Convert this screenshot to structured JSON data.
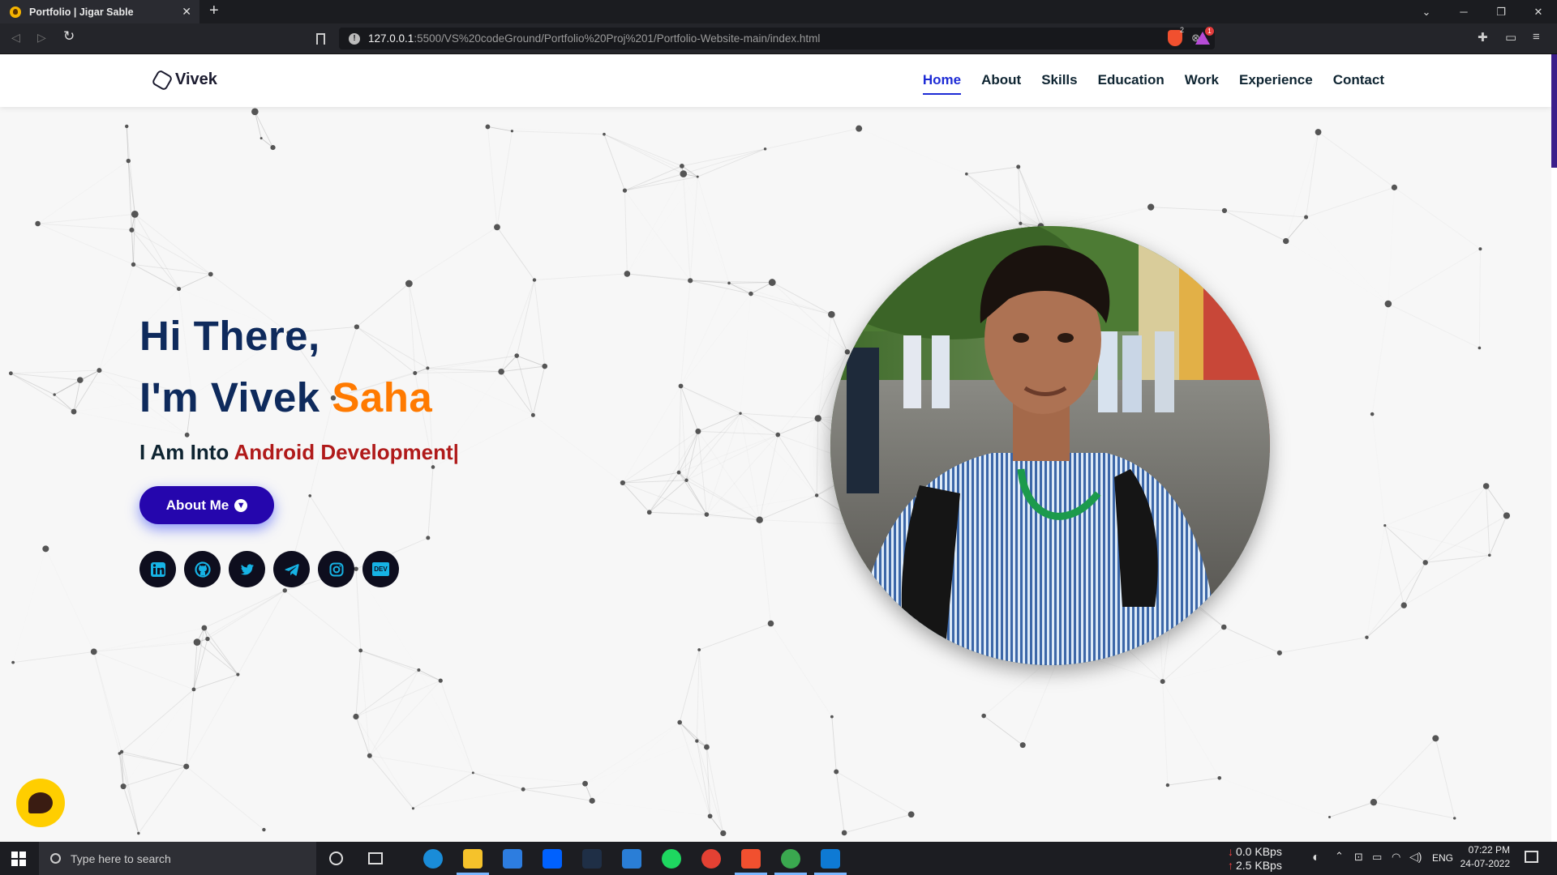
{
  "browser": {
    "tab_title": "Portfolio | Jigar Sable",
    "tab_close": "✕",
    "new_tab": "+",
    "url_host": "127.0.0.1",
    "url_path": ":5500/VS%20codeGround/Portfolio%20Proj%201/Portfolio-Website-main/index.html",
    "brave_badge": "2",
    "alert_badge": "1"
  },
  "site": {
    "logo": "Vivek",
    "nav": [
      "Home",
      "About",
      "Skills",
      "Education",
      "Work",
      "Experience",
      "Contact"
    ],
    "active_nav": "Home",
    "greeting": "Hi There,",
    "name_prefix": "I'm Vivek ",
    "name_accent": "Saha",
    "intro_prefix": "I Am Into ",
    "intro_typed": "Android Development|",
    "about_button": "About Me",
    "social_icons": [
      "linkedin-icon",
      "github-icon",
      "twitter-icon",
      "telegram-icon",
      "instagram-icon",
      "dev-icon"
    ],
    "dev_label": "DEV",
    "accent_color": "#ff7a00",
    "primary_color": "#2506ad"
  },
  "taskbar": {
    "search_placeholder": "Type here to search",
    "net_down": "0.0 KBps",
    "net_up": "2.5 KBps",
    "lang": "ENG",
    "time": "07:22 PM",
    "date": "24-07-2022"
  }
}
